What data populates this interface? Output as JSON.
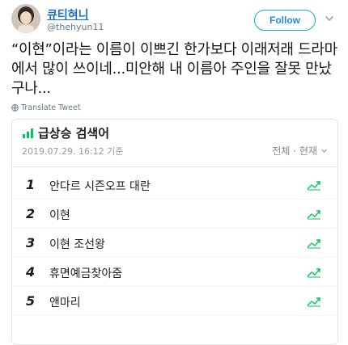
{
  "user": {
    "display_name": "큐티혀니",
    "handle": "@thehyun11"
  },
  "follow_button": "Follow",
  "tweet": {
    "text": "“이현”이라는 이름이 이쁘긴 한가보다 이래저래 드라마에서 많이 쓰이네...미안해 내 이름아 주인을 잘못 만났구나...",
    "translate_label": "Translate Tweet"
  },
  "card": {
    "title": "급상승 검색어",
    "date": "2019.07.29. 16:12 기준",
    "filter": "전체 · 현재",
    "accent_color": "#03c75a",
    "items": [
      {
        "rank": "1",
        "term": "안다르 시즌오프 대란"
      },
      {
        "rank": "2",
        "term": "이현"
      },
      {
        "rank": "3",
        "term": "이현 조선왕"
      },
      {
        "rank": "4",
        "term": "휴면예금찾아줌"
      },
      {
        "rank": "5",
        "term": "앤마리"
      }
    ]
  },
  "icons": {
    "chevron": "chevron-down-icon",
    "globe": "globe-icon",
    "trend": "trend-up-icon",
    "rising": "rising-chart-icon"
  }
}
